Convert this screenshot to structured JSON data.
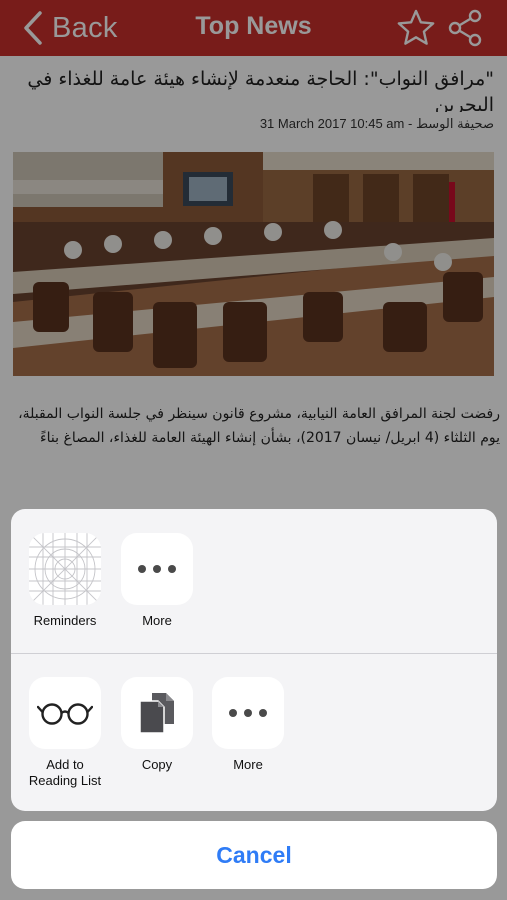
{
  "navbar": {
    "back_label": "Back",
    "title": "Top News",
    "icons": [
      "chevron-left-icon",
      "star-icon",
      "share-icon"
    ],
    "color": "#c9302c"
  },
  "article": {
    "headline": "\"مرافق النواب\": الحاجة منعدمة لإنشاء هيئة عامة للغذاء في البحرين",
    "source": "صحيفة الوسط",
    "timestamp": "31 March 2017 10:45 am",
    "body": "رفضت لجنة المرافق العامة النيابية، مشروع قانون سينظر في جلسة النواب المقبلة، يوم الثلثاء (4 ابريل/ نيسان 2017)، بشأن إنشاء الهيئة العامة للغذاء، المصاغ بناءً"
  },
  "share_sheet": {
    "row1": [
      {
        "label": "Reminders",
        "icon": "reminders-icon"
      },
      {
        "label": "More",
        "icon": "more-icon"
      }
    ],
    "row2": [
      {
        "label": "Add to\nReading List",
        "icon": "glasses-icon"
      },
      {
        "label": "Copy",
        "icon": "copy-icon"
      },
      {
        "label": "More",
        "icon": "more-icon"
      }
    ],
    "cancel_label": "Cancel",
    "accent_color": "#2f7cf6"
  }
}
